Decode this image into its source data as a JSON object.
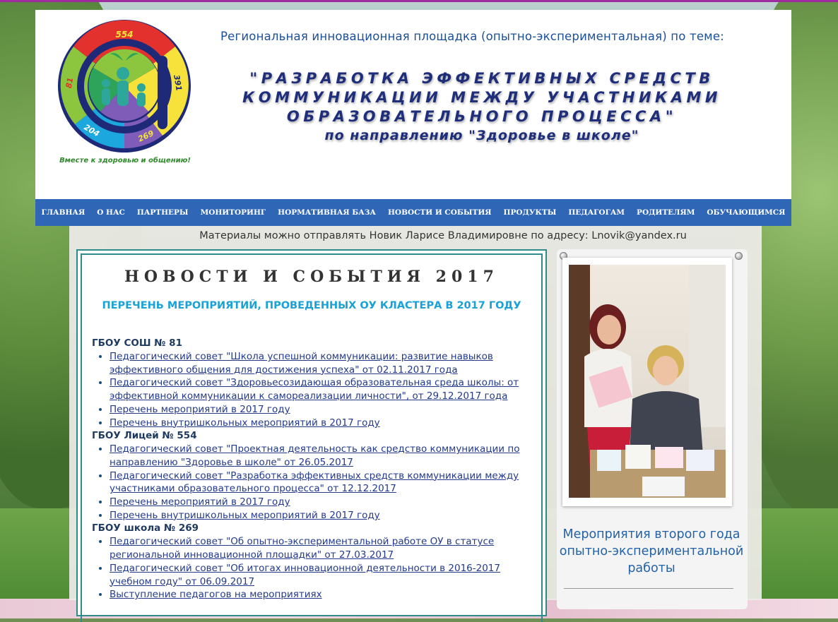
{
  "header": {
    "logo": {
      "numbers": [
        "554",
        "81",
        "391",
        "204",
        "269"
      ],
      "slogan": "Вместе к здоровью и общению!"
    },
    "ri_line": "Региональная инновационная площадка  (опытно-экспериментальная) по теме:",
    "topic_lines": [
      "\"РАЗРАБОТКА ЭФФЕКТИВНЫХ СРЕДСТВ",
      "КОММУНИКАЦИИ МЕЖДУ УЧАСТНИКАМИ",
      "ОБРАЗОВАТЕЛЬНОГО ПРОЦЕССА\""
    ],
    "topic_direction": "по направлению \"Здоровье в школе\""
  },
  "nav": [
    "ГЛАВНАЯ",
    "О НАС",
    "ПАРТНЕРЫ",
    "МОНИТОРИНГ",
    "НОРМАТИВНАЯ БАЗА",
    "НОВОСТИ И СОБЫТИЯ",
    "ПРОДУКТЫ",
    "ПЕДАГОГАМ",
    "РОДИТЕЛЯМ",
    "ОБУЧАЮЩИМСЯ"
  ],
  "notice": "Материалы можно отправлять Новик Ларисе Владимировне по адресу: Lnovik@yandex.ru",
  "news": {
    "title": "НОВОСТИ И СОБЫТИЯ  2017",
    "subtitle": "ПЕРЕЧЕНЬ МЕРОПРИЯТИЙ, ПРОВЕДЕННЫХ  ОУ КЛАСТЕРА В 2017 ГОДУ",
    "schools": [
      {
        "name": "ГБОУ СОШ № 81",
        "items": [
          "Педагогический совет \"Школа успешной коммуникации: развитие навыков эффективного общения для достижения успеха\" от 02.11.2017 года ",
          "Педагогический совет \"Здоровьесозидающая образовательная среда школы: от эффективной коммуникации к самореализации личности\", от 29.12.2017 года ",
          "Перечень мероприятий в 2017 году",
          "Перечень внутришкольных мероприятий в 2017 году"
        ]
      },
      {
        "name": "ГБОУ Лицей № 554",
        "items": [
          "Педагогический совет \"Проектная деятельность как средство коммуникации по направлению \"Здоровье в школе\" от 26.05.2017",
          "Педагогический совет \"Разработка  эффективных средств коммуникации между участниками образовательного процесса\" от 12.12.2017",
          "Перечень мероприятий в 2017 году ",
          "Перечень внутришкольных мероприятий в 2017 году"
        ]
      },
      {
        "name": "ГБОУ школа № 269",
        "items": [
          "Педагогический совет  \"Об опытно-экспериментальной работе ОУ в статусе региональной инновационной площадки\" от 27.03.2017",
          "Педагогический совет  \"Об итогах инновационной деятельности в 2016-2017 учебном году\" от 06.09.2017",
          "Выступление педагогов на мероприятиях"
        ]
      }
    ]
  },
  "sidebar": {
    "caption": "Мероприятия второго года опытно-экспериментальной работы"
  },
  "colors": {
    "nav_bg": "#2f67b6",
    "title_blue": "#1f2e7a",
    "subtitle_cyan": "#1aa1d6",
    "link": "#233a8c",
    "frame_teal": "#2e8b8b"
  }
}
